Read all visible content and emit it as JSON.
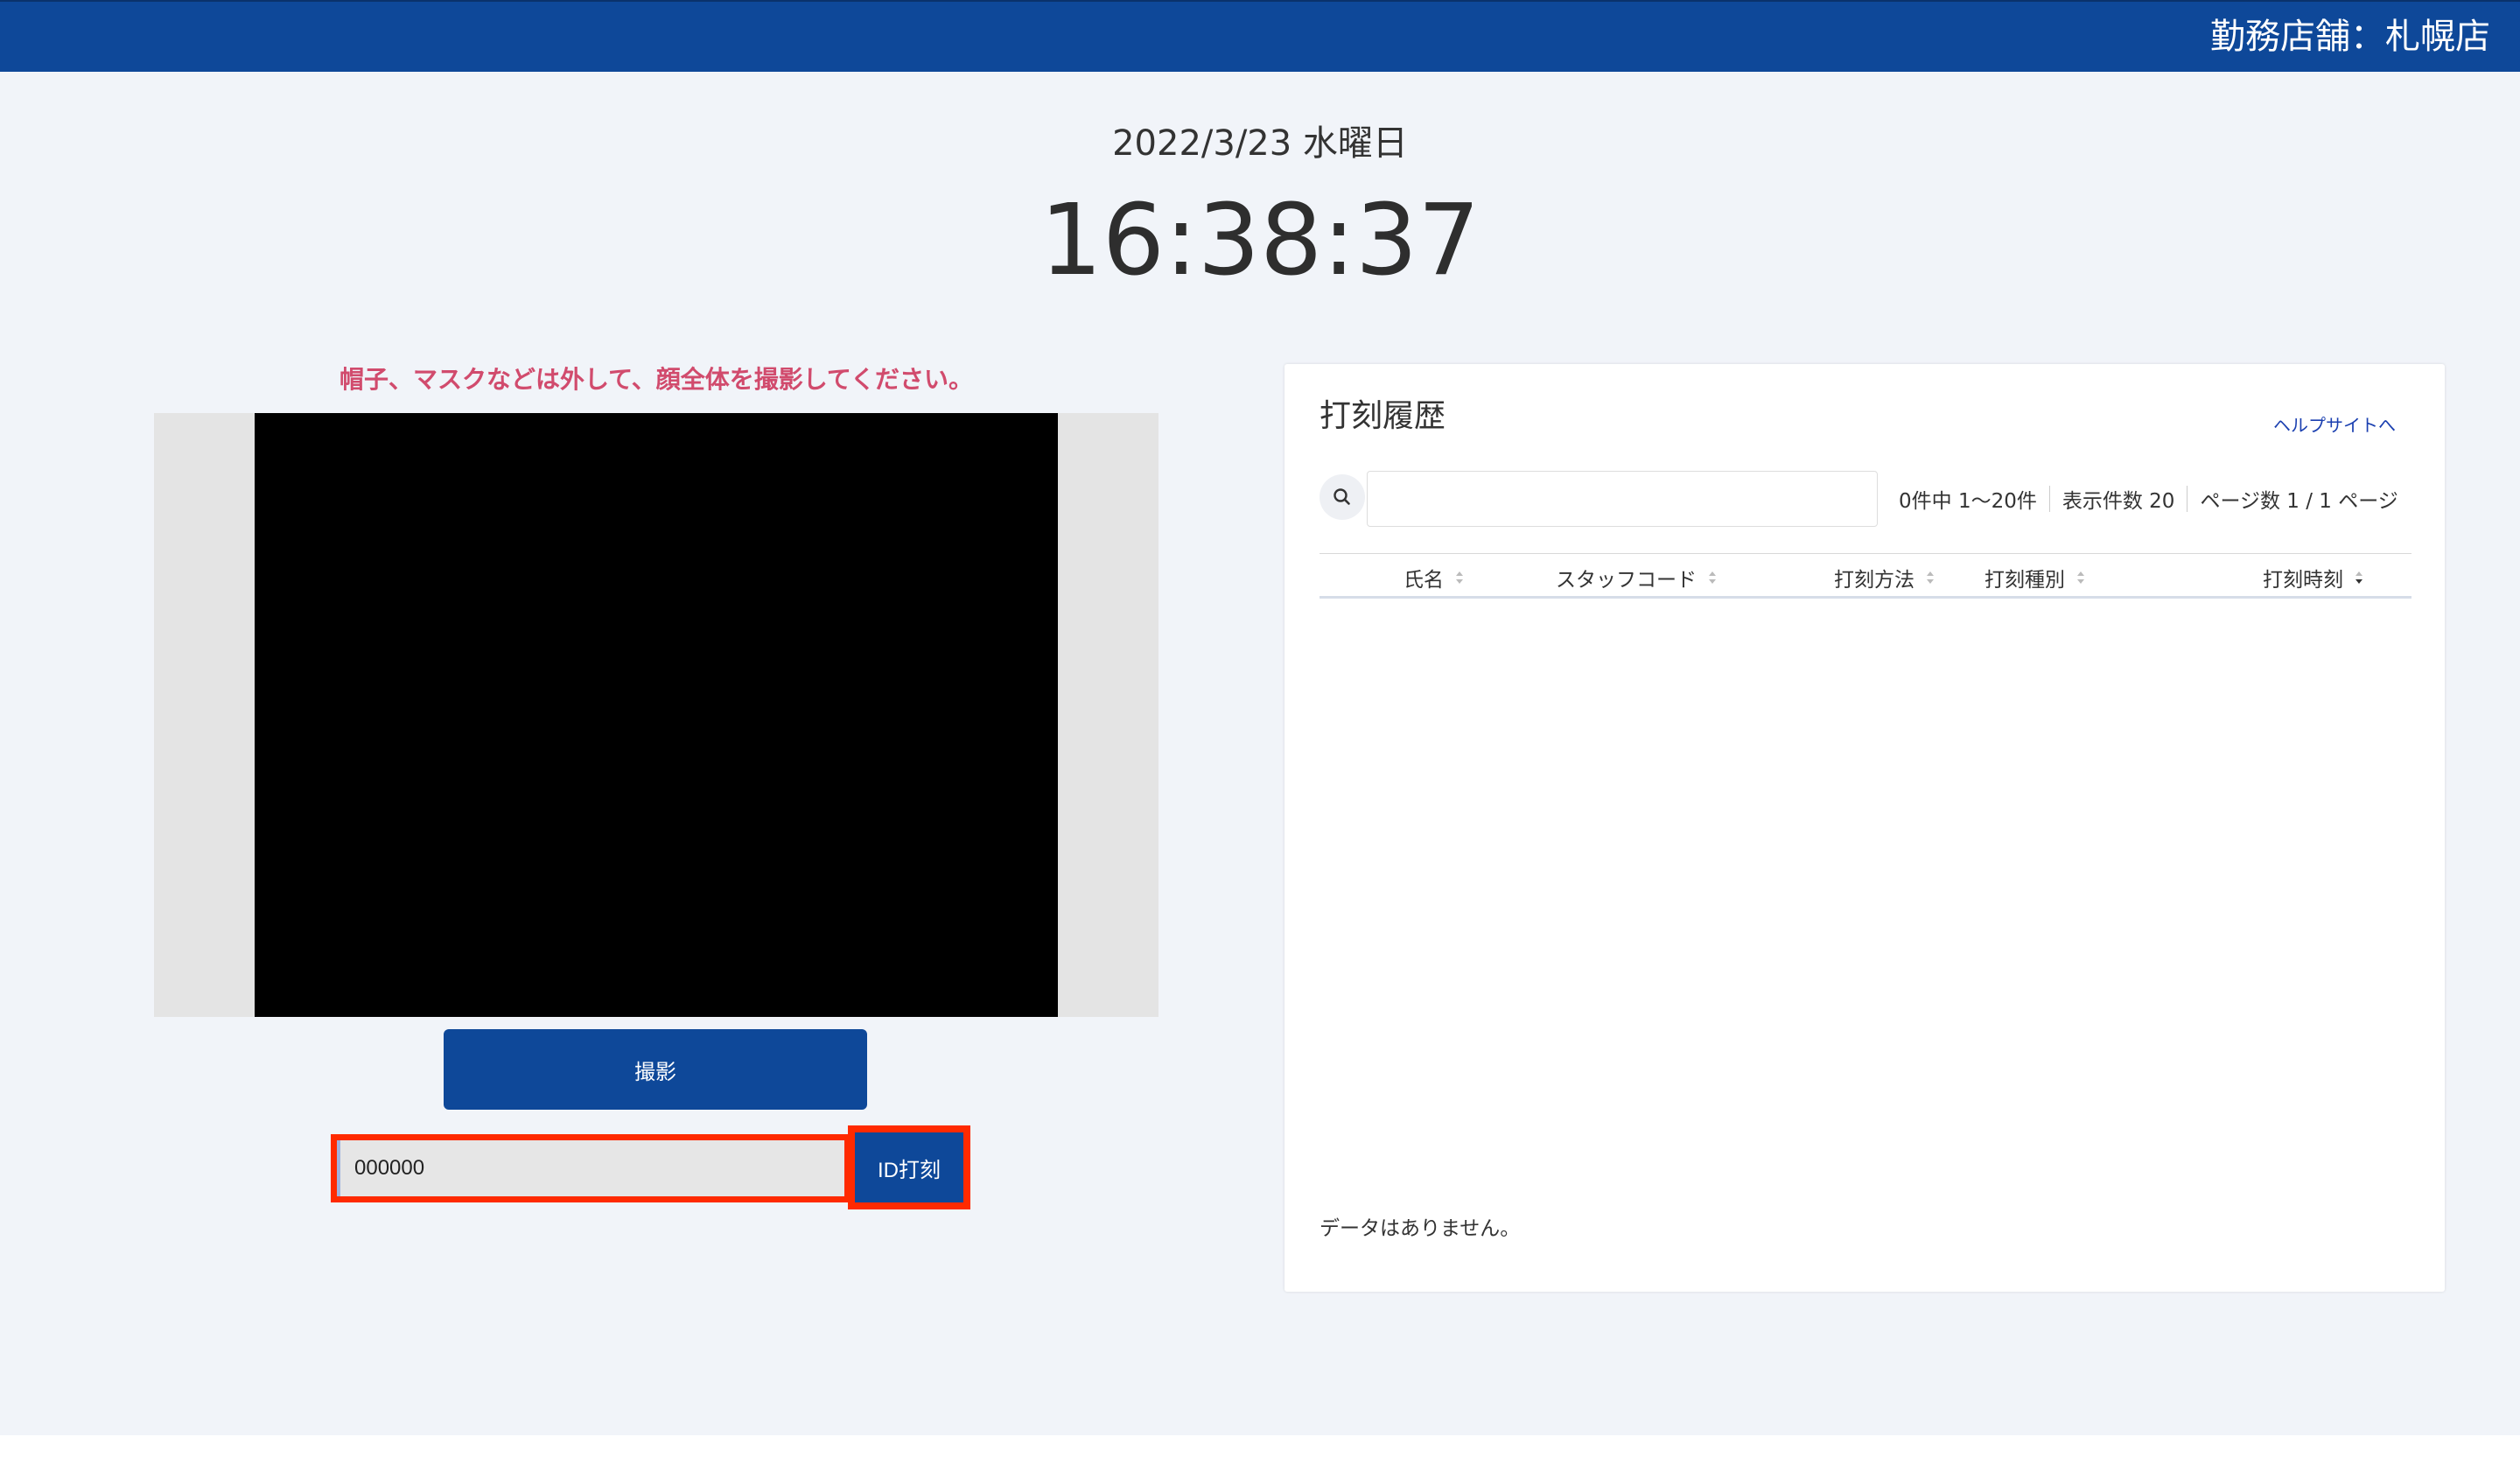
{
  "header": {
    "store_label": "勤務店舗：札幌店"
  },
  "clock": {
    "date": "2022/3/23 水曜日",
    "time": "16:38:37"
  },
  "camera": {
    "notice": "帽子、マスクなどは外して、顔全体を撮影してください。",
    "shoot_label": "撮影"
  },
  "id_punch": {
    "input_value": "000000",
    "button_label": "ID打刻"
  },
  "history": {
    "title": "打刻履歴",
    "help_link": "ヘルプサイトへ",
    "search_value": "",
    "pager": {
      "count": "0件中 1〜20件",
      "per_page": "表示件数 20",
      "pages": "ページ数 1 / 1 ページ"
    },
    "columns": [
      {
        "label": "氏名"
      },
      {
        "label": "スタッフコード"
      },
      {
        "label": "打刻方法"
      },
      {
        "label": "打刻種別"
      },
      {
        "label": "打刻時刻"
      }
    ],
    "empty_message": "データはありません。"
  },
  "colors": {
    "brand": "#0e4899",
    "notice": "#d14b6d",
    "highlight": "#ff2a00",
    "background": "#f1f4f9"
  },
  "icons": {
    "search": "search-icon",
    "sort_both": "sort-icon",
    "sort_desc": "sort-desc-icon"
  }
}
